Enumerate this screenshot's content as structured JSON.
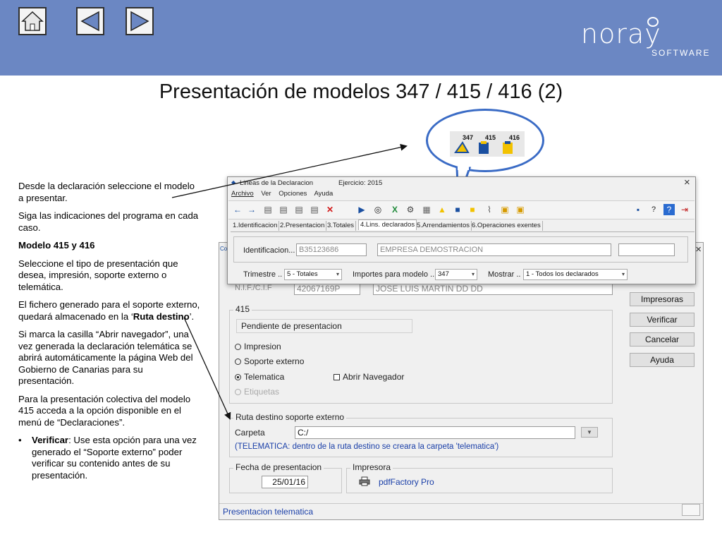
{
  "header": {
    "logo_word": "noray",
    "logo_sub": "SOFTWARE",
    "nav": [
      "home-icon",
      "arrow-left-icon",
      "arrow-right-icon"
    ],
    "band_color": "#6b87c3"
  },
  "slide_title": "Presentación de modelos 347 / 415 / 416 (2)",
  "left_text": {
    "p1": "Desde la declaración seleccione el modelo a presentar.",
    "p2": "Siga las indicaciones del programa en cada caso.",
    "p3_bold": "Modelo 415 y 416",
    "p4": "Seleccione el tipo de presentación que desea, impresión, soporte externo o telemática.",
    "p5_pre": "El fichero generado para el soporte externo, quedará almacenado en la ‘",
    "p5_bold": "Ruta destino",
    "p5_post": "’.",
    "p6": "Si marca la casilla “Abrir navegador”, una vez generada la declaración telemática se abrirá automáticamente la página Web del Gobierno de Canarias para su presentación.",
    "p7": "Para la presentación colectiva del modelo 415 acceda a la opción disponible en el menú de “Declaraciones”.",
    "bullet_dot": "•",
    "bullet_bold": "Verificar",
    "bullet_rest": ": Use esta opción para una vez generado el “Soporte externo” poder verificar su contenido antes de su presentación."
  },
  "bubble": {
    "icons": [
      "347",
      "415",
      "416"
    ]
  },
  "front_window": {
    "title": "Lineas de la Declaracion",
    "ejercicio": "Ejercicio: 2015",
    "close": "×",
    "menu": [
      "Archivo",
      "Ver",
      "Opciones",
      "Ayuda"
    ],
    "tabs": [
      "1.Identificacion",
      "2.Presentacion",
      "3.Totales",
      "4.Lins. declarados",
      "5.Arrendamientos",
      "6.Operaciones exentes"
    ],
    "identificacion_label": "Identificacion...",
    "nif": "B35123686",
    "empresa": "EMPRESA DEMOSTRACION",
    "trimestre_label": "Trimestre ..",
    "trimestre_value": "5 - Totales",
    "importes_label": "Importes para modelo ..",
    "importes_value": "347",
    "mostrar_label": "Mostrar ..",
    "mostrar_value": "1 - Todos los declarados"
  },
  "back_window": {
    "title_fragment": "Co",
    "close": "×",
    "nif_label": "N.I.F./C.I.F",
    "nif_value": "42067169P",
    "nombre_value": "JOSE LUIS MARTIN    DD DD",
    "group_415": "415",
    "status": "Pendiente de presentacion",
    "radios": [
      "Impresion",
      "Soporte externo",
      "Telematica",
      "Etiquetas"
    ],
    "checkbox_label": "Abrir Navegador",
    "buttons": [
      "Impresoras",
      "Verificar",
      "Cancelar",
      "Ayuda"
    ],
    "ruta_group": "Ruta destino soporte externo",
    "carpeta_label": "Carpeta",
    "carpeta_value": "C:/",
    "ruta_note": "(TELEMATICA: dentro de la ruta destino se creara la carpeta 'telematica')",
    "fecha_group": "Fecha de presentacion",
    "fecha_value": "25/01/16",
    "impresora_group": "Impresora",
    "impresora_value": "pdfFactory Pro",
    "statusbar": "Presentacion telematica"
  }
}
